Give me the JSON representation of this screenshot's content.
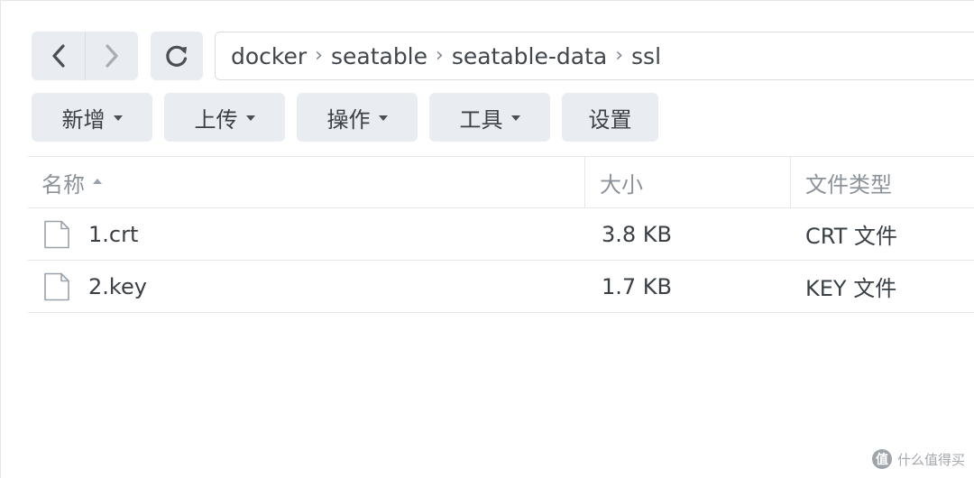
{
  "navigation": {
    "back_icon": "chevron-left-icon",
    "forward_icon": "chevron-right-icon",
    "refresh_icon": "refresh-icon"
  },
  "breadcrumb": {
    "segments": [
      "docker",
      "seatable",
      "seatable-data",
      "ssl"
    ],
    "separator": "›"
  },
  "toolbar": {
    "new_label": "新增",
    "upload_label": "上传",
    "action_label": "操作",
    "tools_label": "工具",
    "settings_label": "设置"
  },
  "table": {
    "columns": {
      "name": "名称",
      "size": "大小",
      "type": "文件类型"
    },
    "rows": [
      {
        "name": "1.crt",
        "size": "3.8 KB",
        "type": "CRT 文件"
      },
      {
        "name": "2.key",
        "size": "1.7 KB",
        "type": "KEY 文件"
      }
    ]
  },
  "watermark": {
    "logo_char": "值",
    "text": "什么值得买"
  },
  "colors": {
    "button_bg": "#e9edf1",
    "border": "#e5e8eb",
    "text": "#3a3f45",
    "muted_text": "#8b9299"
  }
}
